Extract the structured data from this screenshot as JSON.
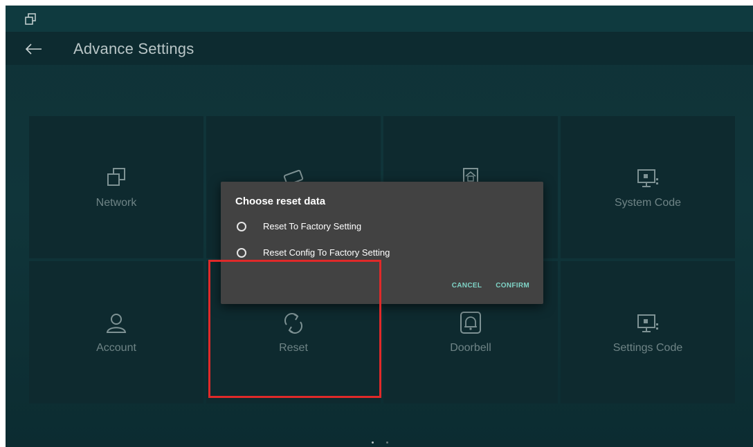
{
  "app_bar": {
    "title": "Advance Settings"
  },
  "tiles": [
    {
      "label": "Network",
      "icon": "network-icon"
    },
    {
      "label": "",
      "icon": "card-icon"
    },
    {
      "label": "",
      "icon": "home-icon"
    },
    {
      "label": "System Code",
      "icon": "monitor-icon"
    },
    {
      "label": "Account",
      "icon": "user-icon"
    },
    {
      "label": "Reset",
      "icon": "refresh-icon"
    },
    {
      "label": "Doorbell",
      "icon": "bell-icon"
    },
    {
      "label": "Settings Code",
      "icon": "monitor-icon"
    }
  ],
  "dialog": {
    "title": "Choose reset data",
    "options": [
      {
        "label": "Reset To Factory Setting",
        "selected": false
      },
      {
        "label": "Reset Config To Factory Setting",
        "selected": false
      }
    ],
    "cancel_label": "CANCEL",
    "confirm_label": "CONFIRM"
  },
  "colors": {
    "accent": "#7fd3c6",
    "highlight": "#e02929",
    "background": "#10353a",
    "dialog": "#424242"
  }
}
